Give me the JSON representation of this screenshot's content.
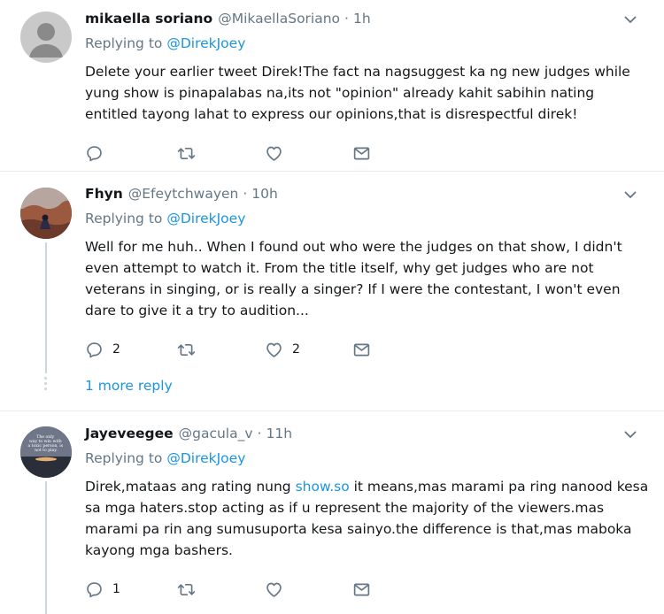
{
  "tweets": [
    {
      "name": "mikaella soriano",
      "handle": "@MikaellaSoriano",
      "separator": "·",
      "time": "1h",
      "replying_prefix": "Replying to",
      "replying_to": "@DirekJoey",
      "lines": [
        "Delete your earlier tweet Direk!The fact na nagsuggest ka ng new judges while",
        "yung show is pinapalabas na,its not \"opinion\" already kahit sabihin nating",
        "entitled tayong lahat to express our opinions,that is disrespectful direk!"
      ],
      "counts": {
        "reply": "",
        "retweet": "",
        "like": ""
      }
    },
    {
      "name": "Fhyn",
      "handle": "@Efeytchwayen",
      "separator": "·",
      "time": "10h",
      "replying_prefix": "Replying to",
      "replying_to": "@DirekJoey",
      "lines": [
        "Well for me huh.. When I found out who were the judges on that show, I didn't",
        "even attempt to watch it. From the title itself, why get judges who are not",
        "veterans in singing, or is really a singer? If I were the contestant, I won't even",
        "dare to give it a try to audition..."
      ],
      "counts": {
        "reply": "2",
        "retweet": "",
        "like": "2"
      },
      "more_replies": "1 more reply"
    },
    {
      "name": "Jayeveegee",
      "handle": "@gacula_v",
      "separator": "·",
      "time": "11h",
      "replying_prefix": "Replying to",
      "replying_to": "@DirekJoey",
      "line1_before": "Direk,mataas ang rating nung ",
      "line1_link": "show.so",
      "line1_after": " it means,mas marami pa ring nanood kesa",
      "lines": [
        "sa mga haters.stop acting as if u represent the majority of the viewers.mas",
        "marami pa rin ang sumusuporta kesa sainyo.the difference is that,mas maboka",
        "kayong mga bashers."
      ],
      "counts": {
        "reply": "1",
        "retweet": "",
        "like": ""
      },
      "avatar_text": "The only way to win with a toxic person, is not to play."
    }
  ],
  "icons": {
    "reply": "reply-icon",
    "retweet": "retweet-icon",
    "like": "like-icon",
    "dm": "message-icon",
    "caret": "chevron-down-icon"
  },
  "colors": {
    "link": "#1b95e0",
    "secondary": "#657786",
    "thread": "#ccd6dd",
    "divider": "#e6ecf0"
  }
}
